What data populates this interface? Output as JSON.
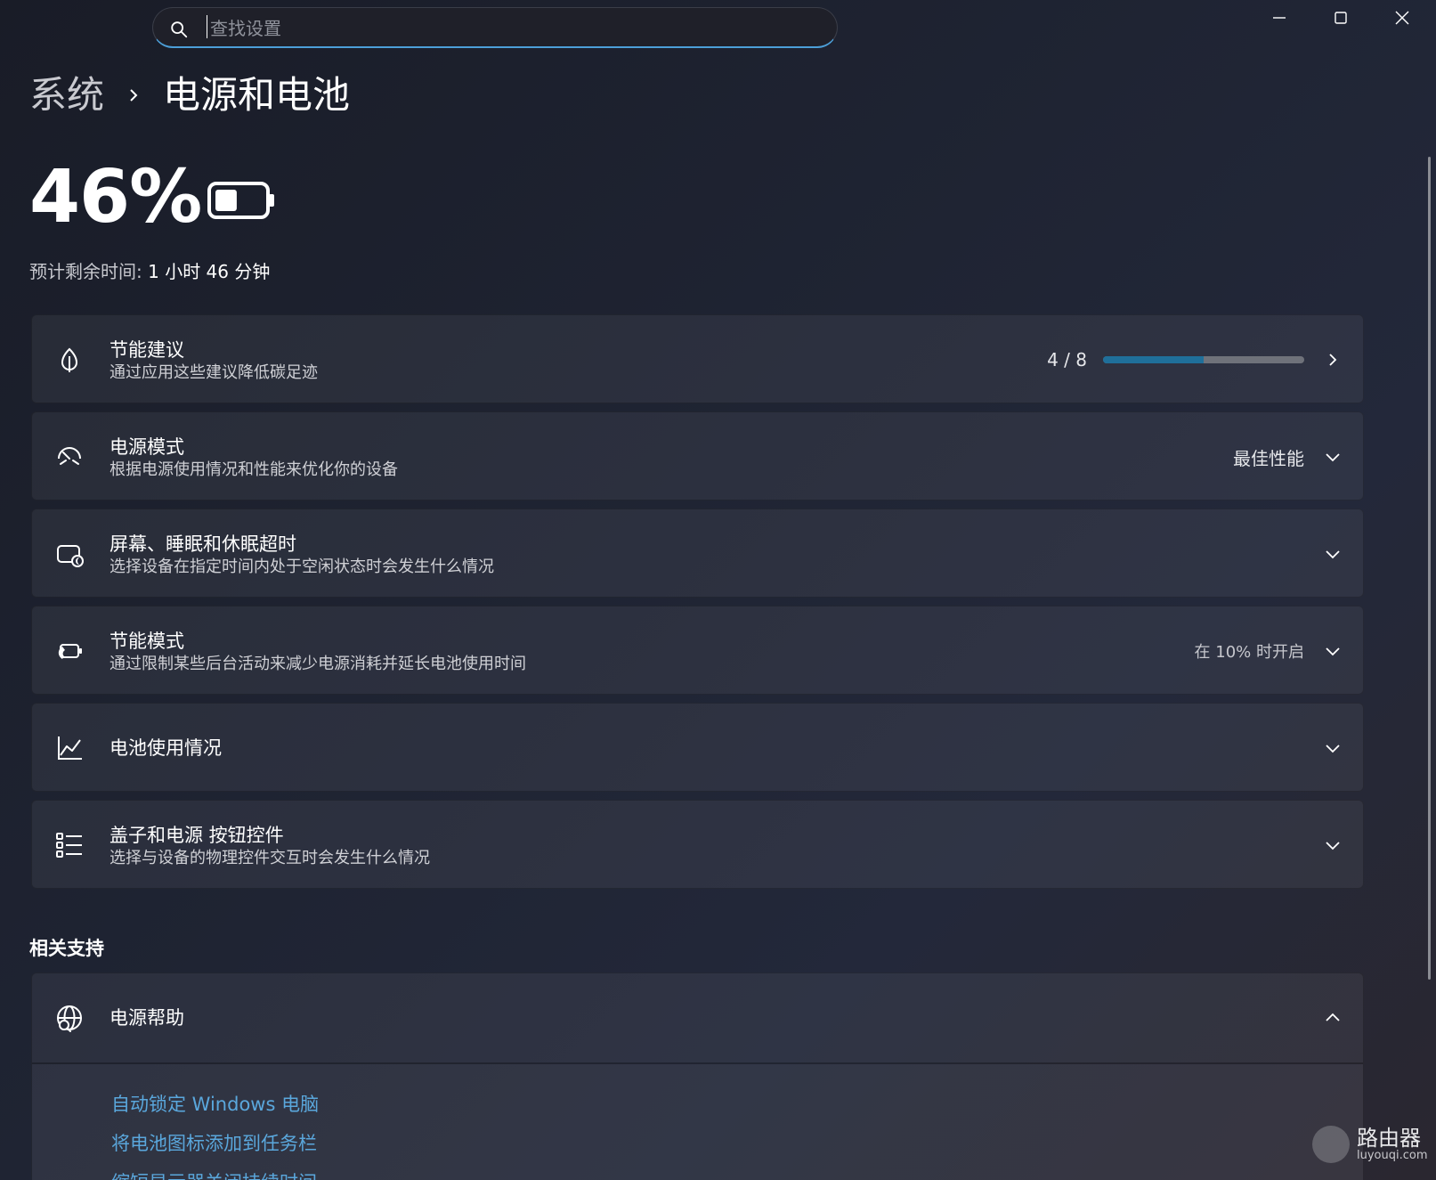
{
  "search": {
    "placeholder": "查找设置",
    "value": ""
  },
  "breadcrumb": {
    "parent": "系统",
    "current": "电源和电池"
  },
  "battery": {
    "percent_label": "46%",
    "level": 0.46,
    "remaining_label": "预计剩余时间:",
    "remaining_value": "1 小时 46 分钟"
  },
  "cards": [
    {
      "title": "节能建议",
      "subtitle": "通过应用这些建议降低碳足迹",
      "icon": "leaf-icon",
      "progress_label": "4 / 8",
      "progress": 0.5,
      "control": "chevron-right-icon"
    },
    {
      "title": "电源模式",
      "subtitle": "根据电源使用情况和性能来优化你的设备",
      "icon": "gauge-icon",
      "value": "最佳性能",
      "control": "chevron-down-icon"
    },
    {
      "title": "屏幕、睡眠和休眠超时",
      "subtitle": "选择设备在指定时间内处于空闲状态时会发生什么情况",
      "icon": "screen-sleep-icon",
      "control": "chevron-down-icon"
    },
    {
      "title": "节能模式",
      "subtitle": "通过限制某些后台活动来减少电源消耗并延长电池使用时间",
      "icon": "battery-saver-icon",
      "value": "在 10% 时开启",
      "control": "chevron-down-icon"
    },
    {
      "title": "电池使用情况",
      "icon": "chart-icon",
      "control": "chevron-down-icon"
    },
    {
      "title": "盖子和电源 按钮控件",
      "subtitle": "选择与设备的物理控件交互时会发生什么情况",
      "icon": "list-icon",
      "control": "chevron-down-icon"
    }
  ],
  "related": {
    "section_title": "相关支持",
    "help_title": "电源帮助",
    "help_icon": "globe-help-icon",
    "links": [
      "自动锁定 Windows 电脑",
      "将电池图标添加到任务栏",
      "缩短显示器关闭持续时间"
    ]
  },
  "watermark": {
    "name": "路由器",
    "site": "luyouqi.com"
  },
  "colors": {
    "accent": "#4c9fd8",
    "link": "#5aa7dc",
    "progress_fill": "#1f6f9a"
  }
}
